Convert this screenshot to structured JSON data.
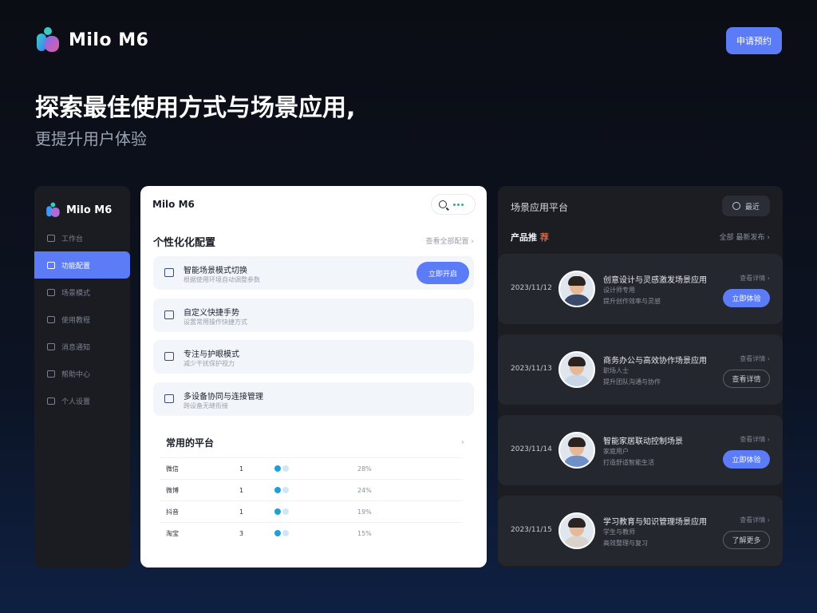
{
  "header": {
    "brand": "Milo M6",
    "cta_label": "申请预约",
    "hero_title": "探索最佳使用方式与场景应用,",
    "hero_subtitle": "更提升用户体验"
  },
  "sidebar": {
    "brand": "Milo M6",
    "items": [
      {
        "label": "工作台"
      },
      {
        "label": "功能配置"
      },
      {
        "label": "场景模式"
      },
      {
        "label": "使用教程"
      },
      {
        "label": "消息通知"
      },
      {
        "label": "帮助中心"
      },
      {
        "label": "个人设置"
      }
    ],
    "active_index": 1
  },
  "panel": {
    "title": "Milo M6",
    "section_title": "个性化化配置",
    "section_link": "查看全部配置 ›",
    "configs": [
      {
        "title": "智能场景模式切换",
        "desc": "根据使用环境自动调整参数",
        "action": "立即开启"
      },
      {
        "title": "自定义快捷手势",
        "desc": "设置常用操作快捷方式",
        "action": ""
      },
      {
        "title": "专注与护眼模式",
        "desc": "减少干扰保护视力",
        "action": ""
      },
      {
        "title": "多设备协同与连接管理",
        "desc": "跨设备无缝衔接",
        "action": ""
      }
    ],
    "platform_title": "常用的平台",
    "platform_rows": [
      {
        "name": "微信",
        "count": "1",
        "status": "28%"
      },
      {
        "name": "微博",
        "count": "1",
        "status": "24%"
      },
      {
        "name": "抖音",
        "count": "1",
        "status": "19%"
      },
      {
        "name": "淘宝",
        "count": "3",
        "status": "15%"
      }
    ]
  },
  "rpanel": {
    "title": "场景应用平台",
    "time_button": "最近",
    "sub_title": "产品推荐",
    "sub_highlight": "荐",
    "sub_links": "全部  最新发布 ›",
    "cards": [
      {
        "time": "2023/11/12",
        "title": "创意设计与灵感激发场景应用",
        "line1": "设计师专用",
        "line2": "提升创作效率与灵感",
        "meta": "查看详情 ›",
        "action": "立即体验",
        "style": "primary",
        "shirt": "#3a4a6a"
      },
      {
        "time": "2023/11/13",
        "title": "商务办公与高效协作场景应用",
        "line1": "职场人士",
        "line2": "提升团队沟通与协作",
        "meta": "查看详情 ›",
        "action": "查看详情",
        "style": "outline",
        "shirt": "#c9d6e8"
      },
      {
        "time": "2023/11/14",
        "title": "智能家居联动控制场景",
        "line1": "家庭用户",
        "line2": "打造舒适智能生活",
        "meta": "查看详情 ›",
        "action": "立即体验",
        "style": "primary",
        "shirt": "#6f8fc9"
      },
      {
        "time": "2023/11/15",
        "title": "学习教育与知识管理场景应用",
        "line1": "学生与教师",
        "line2": "高效整理与复习",
        "meta": "查看详情 ›",
        "action": "了解更多",
        "style": "outline",
        "shirt": "#d9d3cc"
      }
    ]
  },
  "colors": {
    "accent": "#5b7cf6",
    "highlight": "#e0623d",
    "background": "#0b0d14"
  }
}
